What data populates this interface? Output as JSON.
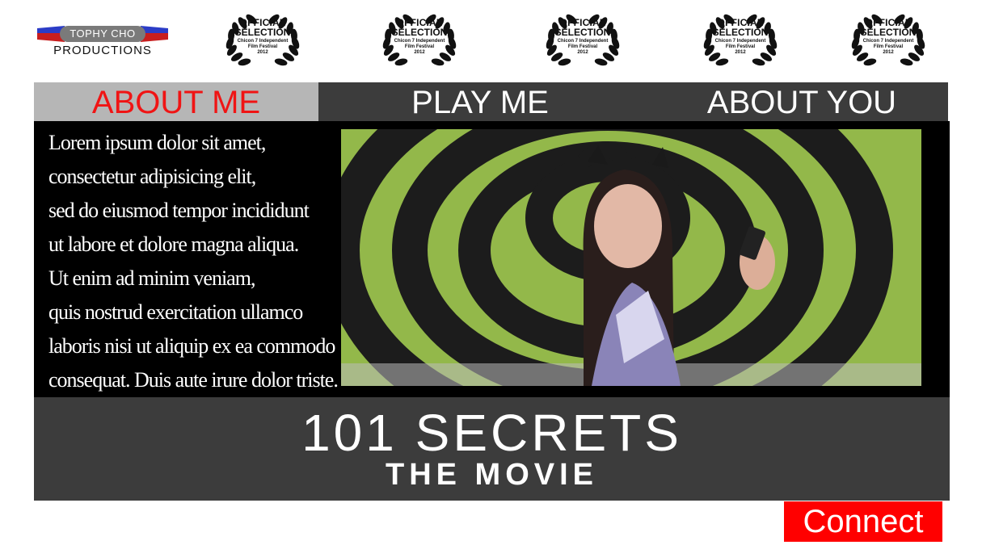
{
  "logo": {
    "top_text": "TOPHY CHO",
    "bottom_text": "PRODUCTIONS"
  },
  "laurels": [
    {
      "line1": "OFFICIAL",
      "line2": "SELECTION",
      "festival": "Chicon 7 Independent",
      "festival2": "Film Festival",
      "year": "2012"
    },
    {
      "line1": "OFFICIAL",
      "line2": "SELECTION",
      "festival": "Chicon 7 Independent",
      "festival2": "Film Festival",
      "year": "2012"
    },
    {
      "line1": "OFFICIAL",
      "line2": "SELECTION",
      "festival": "Chicon 7 Independent",
      "festival2": "Film Festival",
      "year": "2012"
    },
    {
      "line1": "OFFICIAL",
      "line2": "SELECTION",
      "festival": "Chicon 7 Independent",
      "festival2": "Film Festival",
      "year": "2012"
    },
    {
      "line1": "OFFICIAL",
      "line2": "SELECTION",
      "festival": "Chicon 7 Independent",
      "festival2": "Film Festival",
      "year": "2012"
    }
  ],
  "nav": {
    "about_me": "ABOUT ME",
    "play_me": "PLAY ME",
    "about_you": "ABOUT YOU"
  },
  "body_text": [
    "Lorem ipsum dolor sit amet,",
    "consectetur adipisicing elit,",
    "sed do eiusmod tempor incididunt",
    "ut labore et dolore magna aliqua.",
    "Ut enim ad minim veniam,",
    "quis nostrud exercitation ullamco",
    "laboris nisi ut aliquip ex ea commodo",
    "consequat. Duis aute irure dolor triste."
  ],
  "title": {
    "main": "101 SECRETS",
    "sub": "THE MOVIE"
  },
  "connect_label": "Connect",
  "colors": {
    "nav_active_bg": "#b6b6b6",
    "nav_active_text": "#f01414",
    "bar_bg": "#3c3c3c",
    "connect_bg": "#ff0000"
  }
}
